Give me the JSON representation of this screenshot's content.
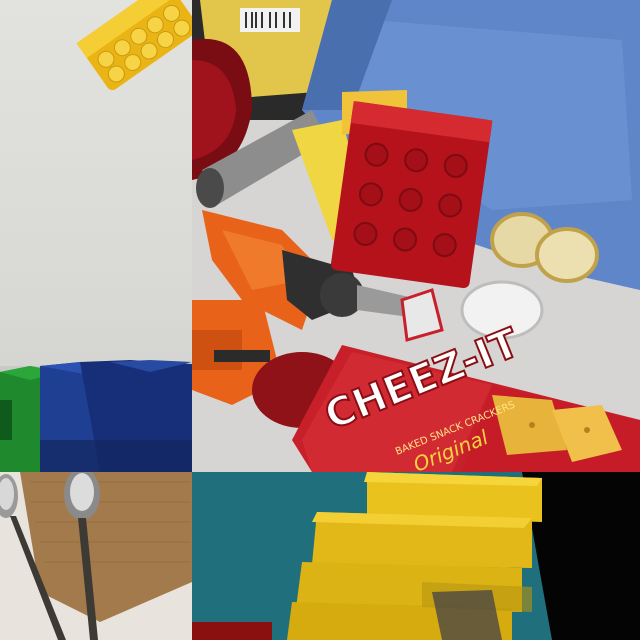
{
  "collage": {
    "tiles": [
      {
        "id": "top-left",
        "subject": "yellow lego brick and blue/green mega blocks"
      },
      {
        "id": "center",
        "subject": "cluttered pile: cheez-it box, orange drill, red lego brick, blue bin"
      },
      {
        "id": "bottom-left",
        "subject": "two spoons on burlap"
      },
      {
        "id": "bottom-right",
        "subject": "stacked yellow blocks against teal background"
      }
    ]
  },
  "center_scene": {
    "cheezit_brand": "CHEEZ-IT",
    "cheezit_variant": "Original",
    "cheezit_small_text": "BAKED SNACK CRACKERS"
  },
  "colors": {
    "cheezit_red": "#c8202a",
    "lego_yellow": "#f2c21b",
    "lego_red": "#b5121b",
    "drill_orange": "#e8621a",
    "bin_blue": "#5f86c8",
    "teal_bg": "#1f6f7c",
    "block_blue": "#1e3c8a",
    "block_green": "#1c7a2a"
  }
}
